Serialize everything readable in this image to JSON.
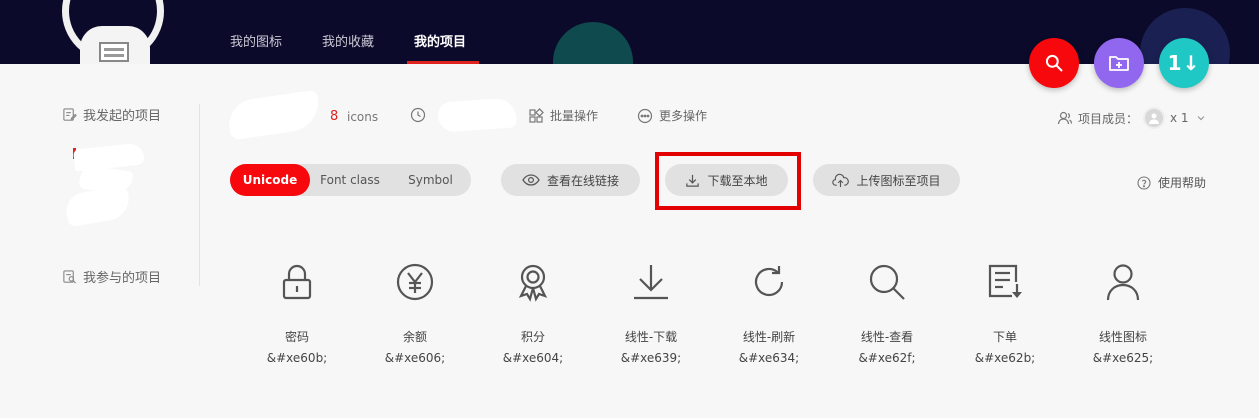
{
  "nav": {
    "tabs": [
      {
        "label": "我的图标"
      },
      {
        "label": "我的收藏"
      },
      {
        "label": "我的项目"
      }
    ],
    "active_index": 2
  },
  "header_actions": {
    "search_icon": "search-icon",
    "new_folder_icon": "folder-plus-icon",
    "sort_label": "1↓"
  },
  "sidebar": {
    "my_projects": "我发起的项目",
    "joined_projects": "我参与的项目"
  },
  "project": {
    "count": "8",
    "count_unit": "icons",
    "batch_label": "批量操作",
    "more_label": "更多操作",
    "members_label": "项目成员：",
    "members_count": "x 1"
  },
  "format_tabs": [
    {
      "label": "Unicode"
    },
    {
      "label": "Font class"
    },
    {
      "label": "Symbol"
    }
  ],
  "format_active": 0,
  "actions": {
    "view_online": "查看在线链接",
    "download": "下载至本地",
    "upload": "上传图标至项目",
    "help": "使用帮助"
  },
  "icons": [
    {
      "icon": "lock-icon",
      "name": "密码",
      "code": "&#xe60b;"
    },
    {
      "icon": "yen-icon",
      "name": "余额",
      "code": "&#xe606;"
    },
    {
      "icon": "medal-icon",
      "name": "积分",
      "code": "&#xe604;"
    },
    {
      "icon": "download-icon",
      "name": "线性-下载",
      "code": "&#xe639;"
    },
    {
      "icon": "refresh-icon",
      "name": "线性-刷新",
      "code": "&#xe634;"
    },
    {
      "icon": "search-icon",
      "name": "线性-查看",
      "code": "&#xe62f;"
    },
    {
      "icon": "order-icon",
      "name": "下单",
      "code": "&#xe62b;"
    },
    {
      "icon": "user-icon",
      "name": "线性图标",
      "code": "&#xe625;"
    }
  ],
  "colors": {
    "brand_red": "#f6080c",
    "header_bg": "#0c0a2a",
    "purple": "#9267f0",
    "teal": "#20c8c5",
    "highlight": "#e30000"
  }
}
